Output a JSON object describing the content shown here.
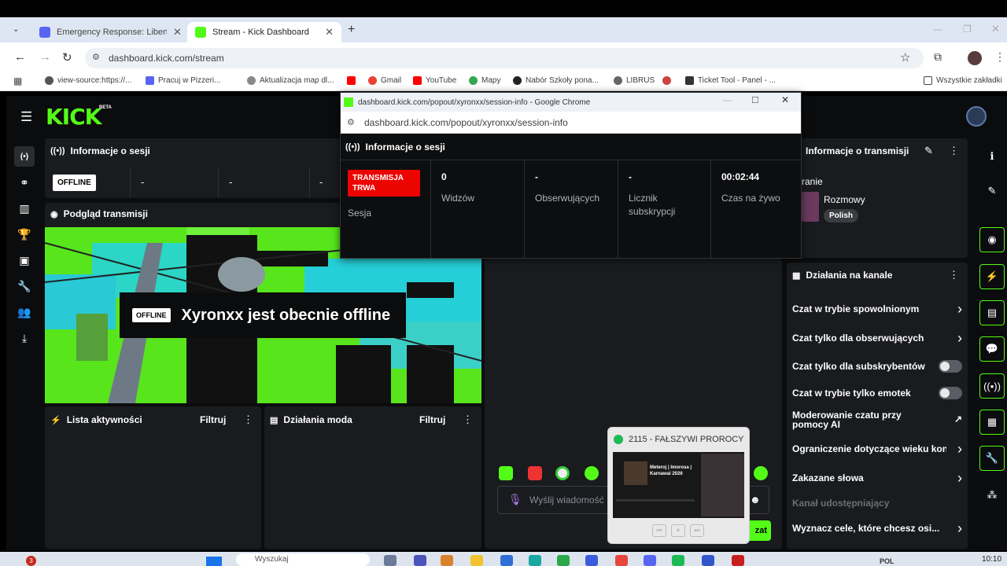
{
  "browser": {
    "tabs": [
      {
        "title": "Emergency Response: Liberty C",
        "active": false,
        "favicon_color": "#5865f2"
      },
      {
        "title": "Stream - Kick Dashboard",
        "active": true,
        "favicon_color": "#53fc18"
      }
    ],
    "new_tab": "+",
    "url": "dashboard.kick.com/stream",
    "bookmarks": [
      {
        "label": "view-source:https://...",
        "color": "#555"
      },
      {
        "label": "Pracuj w Pizzeri...",
        "color": "#d33"
      },
      {
        "label": "Aktualizacja map dl...",
        "color": "#888"
      },
      {
        "label": "",
        "color": "#f00"
      },
      {
        "label": "Gmail",
        "color": "#ea4335"
      },
      {
        "label": "YouTube",
        "color": "#f00"
      },
      {
        "label": "Mapy",
        "color": "#34a853"
      },
      {
        "label": "Nabór Szkoły pona...",
        "color": "#222"
      },
      {
        "label": "LIBRUS",
        "color": "#666"
      },
      {
        "label": "",
        "color": "#c44"
      },
      {
        "label": "Ticket Tool - Panel - ...",
        "color": "#333"
      }
    ],
    "all_bookmarks": "Wszystkie zakładki"
  },
  "kick": {
    "logo": "KICK",
    "beta": "BETA",
    "session_panel": {
      "title": "Informacje o sesji",
      "status": "OFFLINE",
      "values": [
        "-",
        "-",
        "-"
      ]
    },
    "preview_panel": {
      "title": "Podgląd transmisji",
      "offline_badge": "OFFLINE",
      "offline_text": "Xyronxx jest obecnie offline",
      "bg_letters": "OFF-LINE"
    },
    "activity_panel": {
      "title": "Lista aktywności",
      "filter": "Filtruj"
    },
    "mod_panel": {
      "title": "Działania moda",
      "filter": "Filtruj"
    },
    "stream_info": {
      "title": "Informacje o transmisji",
      "partial_label": "ranie",
      "category": "Rozmowy",
      "language": "Polish"
    },
    "channel_actions": {
      "title": "Działania na kanale",
      "items": [
        {
          "label": "Czat w trybie spowolnionym",
          "control": "chevron"
        },
        {
          "label": "Czat tylko dla obserwujących",
          "control": "chevron"
        },
        {
          "label": "Czat tylko dla subskrybentów",
          "control": "toggle"
        },
        {
          "label": "Czat w trybie tylko emotek",
          "control": "toggle"
        },
        {
          "label": "Moderowanie czatu przy pomocy AI",
          "control": "external"
        },
        {
          "label": "Ograniczenie dotyczące wieku kon",
          "control": "chevron"
        },
        {
          "label": "Zakazane słowa",
          "control": "chevron"
        },
        {
          "label": "Kanał udostępniający",
          "control": "none"
        },
        {
          "label": "Wyznacz cele, które chcesz osi...",
          "control": "chevron"
        }
      ]
    },
    "chat": {
      "placeholder": "Wyślij wiadomość",
      "send_label": "zat"
    }
  },
  "popout": {
    "window_title": "dashboard.kick.com/popout/xyronxx/session-info - Google Chrome",
    "url": "dashboard.kick.com/popout/xyronxx/session-info",
    "panel_title": "Informacje o sesji",
    "status_badge": "TRANSMISJA TRWA",
    "status_label": "Sesja",
    "stats": [
      {
        "value": "0",
        "label": "Widzów"
      },
      {
        "value": "-",
        "label": "Obserwujących"
      },
      {
        "value": "-",
        "label": "Licznik subskrypcji"
      },
      {
        "value": "00:02:44",
        "label": "Czas na żywo"
      }
    ]
  },
  "mini_player": {
    "title": "2115 - FAŁSZYWI PROROCY",
    "thumb_title": "Meteroj | Imorosa | Karnawal 2026"
  },
  "taskbar": {
    "notification_count": "3",
    "search_placeholder": "Wyszukaj",
    "lang": "POL",
    "time": "10:10"
  },
  "colors": {
    "kick_green": "#53fc18",
    "live_red": "#eb0400",
    "panel_bg": "#191b1f"
  }
}
